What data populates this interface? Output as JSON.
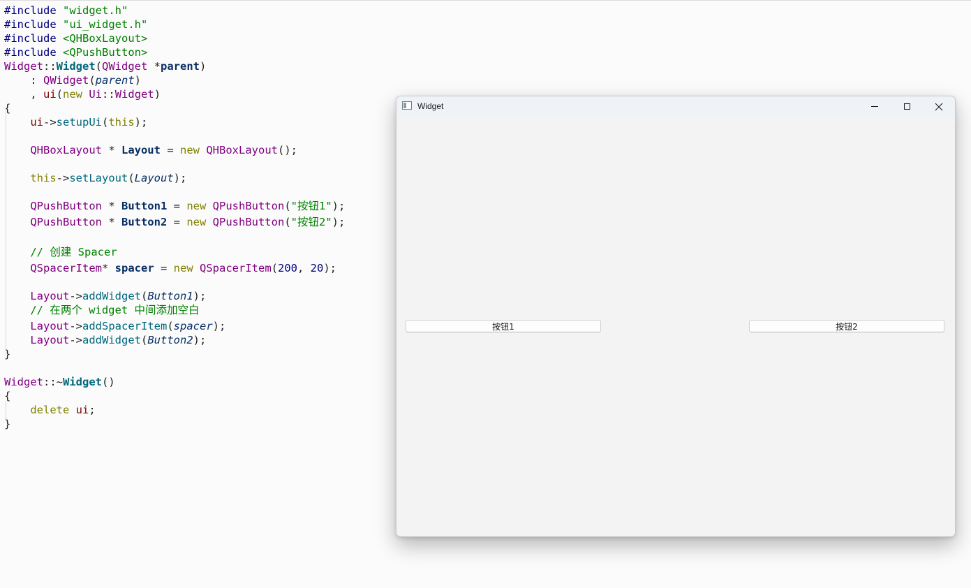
{
  "editor": {
    "lines": [
      [
        [
          "pp",
          "#include "
        ],
        [
          "str",
          "\"widget.h\""
        ]
      ],
      [
        [
          "pp",
          "#include "
        ],
        [
          "str",
          "\"ui_widget.h\""
        ]
      ],
      [
        [
          "pp",
          "#include "
        ],
        [
          "str",
          "<QHBoxLayout>"
        ]
      ],
      [
        [
          "pp",
          "#include "
        ],
        [
          "str",
          "<QPushButton>"
        ]
      ],
      [
        [
          "ty",
          "Widget"
        ],
        [
          "pl",
          "::"
        ],
        [
          "fnb",
          "Widget"
        ],
        [
          "pl",
          "("
        ],
        [
          "ty",
          "QWidget"
        ],
        [
          "pl",
          " *"
        ],
        [
          "bold",
          "parent"
        ],
        [
          "pl",
          ")"
        ]
      ],
      [
        [
          "pl",
          "    : "
        ],
        [
          "ty",
          "QWidget"
        ],
        [
          "pl",
          "("
        ],
        [
          "it",
          "parent"
        ],
        [
          "pl",
          ")"
        ]
      ],
      [
        [
          "pl",
          "    , "
        ],
        [
          "var",
          "ui"
        ],
        [
          "pl",
          "("
        ],
        [
          "kw",
          "new"
        ],
        [
          "pl",
          " "
        ],
        [
          "ty",
          "Ui"
        ],
        [
          "pl",
          "::"
        ],
        [
          "ty",
          "Widget"
        ],
        [
          "pl",
          ")"
        ]
      ],
      [
        [
          "pl",
          "{"
        ]
      ],
      [
        [
          "pl",
          "    "
        ],
        [
          "var",
          "ui"
        ],
        [
          "pl",
          "->"
        ],
        [
          "fn",
          "setupUi"
        ],
        [
          "pl",
          "("
        ],
        [
          "kw",
          "this"
        ],
        [
          "pl",
          ");"
        ]
      ],
      [],
      [
        [
          "pl",
          "    "
        ],
        [
          "ty",
          "QHBoxLayout"
        ],
        [
          "pl",
          " * "
        ],
        [
          "bold",
          "Layout"
        ],
        [
          "pl",
          " = "
        ],
        [
          "kw",
          "new"
        ],
        [
          "pl",
          " "
        ],
        [
          "ty",
          "QHBoxLayout"
        ],
        [
          "pl",
          "();"
        ]
      ],
      [],
      [
        [
          "pl",
          "    "
        ],
        [
          "kw",
          "this"
        ],
        [
          "pl",
          "->"
        ],
        [
          "fn",
          "setLayout"
        ],
        [
          "pl",
          "("
        ],
        [
          "it",
          "Layout"
        ],
        [
          "pl",
          ");"
        ]
      ],
      [],
      [
        [
          "pl",
          "    "
        ],
        [
          "ty",
          "QPushButton"
        ],
        [
          "pl",
          " * "
        ],
        [
          "bold",
          "Button1"
        ],
        [
          "pl",
          " = "
        ],
        [
          "kw",
          "new"
        ],
        [
          "pl",
          " "
        ],
        [
          "ty",
          "QPushButton"
        ],
        [
          "pl",
          "("
        ],
        [
          "str",
          "\"按钮1\""
        ],
        [
          "pl",
          ");"
        ]
      ],
      [
        [
          "pl",
          "    "
        ],
        [
          "ty",
          "QPushButton"
        ],
        [
          "pl",
          " * "
        ],
        [
          "bold",
          "Button2"
        ],
        [
          "pl",
          " = "
        ],
        [
          "kw",
          "new"
        ],
        [
          "pl",
          " "
        ],
        [
          "ty",
          "QPushButton"
        ],
        [
          "pl",
          "("
        ],
        [
          "str",
          "\"按钮2\""
        ],
        [
          "pl",
          ");"
        ]
      ],
      [],
      [
        [
          "pl",
          "    "
        ],
        [
          "cm",
          "// 创建 Spacer"
        ]
      ],
      [
        [
          "pl",
          "    "
        ],
        [
          "ty",
          "QSpacerItem"
        ],
        [
          "pl",
          "* "
        ],
        [
          "bold",
          "spacer"
        ],
        [
          "pl",
          " = "
        ],
        [
          "kw",
          "new"
        ],
        [
          "pl",
          " "
        ],
        [
          "ty",
          "QSpacerItem"
        ],
        [
          "pl",
          "("
        ],
        [
          "num",
          "200"
        ],
        [
          "pl",
          ", "
        ],
        [
          "num",
          "20"
        ],
        [
          "pl",
          ");"
        ]
      ],
      [],
      [
        [
          "pl",
          "    "
        ],
        [
          "ty",
          "Layout"
        ],
        [
          "pl",
          "->"
        ],
        [
          "fn",
          "addWidget"
        ],
        [
          "pl",
          "("
        ],
        [
          "it",
          "Button1"
        ],
        [
          "pl",
          ");"
        ]
      ],
      [
        [
          "pl",
          "    "
        ],
        [
          "cm",
          "// 在两个 widget 中间添加空白"
        ]
      ],
      [
        [
          "pl",
          "    "
        ],
        [
          "ty",
          "Layout"
        ],
        [
          "pl",
          "->"
        ],
        [
          "fn",
          "addSpacerItem"
        ],
        [
          "pl",
          "("
        ],
        [
          "it",
          "spacer"
        ],
        [
          "pl",
          ");"
        ]
      ],
      [
        [
          "pl",
          "    "
        ],
        [
          "ty",
          "Layout"
        ],
        [
          "pl",
          "->"
        ],
        [
          "fn",
          "addWidget"
        ],
        [
          "pl",
          "("
        ],
        [
          "it",
          "Button2"
        ],
        [
          "pl",
          ");"
        ]
      ],
      [
        [
          "pl",
          "}"
        ]
      ],
      [],
      [
        [
          "ty",
          "Widget"
        ],
        [
          "pl",
          "::~"
        ],
        [
          "fnb",
          "Widget"
        ],
        [
          "pl",
          "()"
        ]
      ],
      [
        [
          "pl",
          "{"
        ]
      ],
      [
        [
          "pl",
          "    "
        ],
        [
          "kw",
          "delete"
        ],
        [
          "pl",
          " "
        ],
        [
          "var",
          "ui"
        ],
        [
          "pl",
          ";"
        ]
      ],
      [
        [
          "pl",
          "}"
        ]
      ]
    ]
  },
  "window": {
    "title": "Widget",
    "button1_label": "按钮1",
    "button2_label": "按钮2"
  }
}
